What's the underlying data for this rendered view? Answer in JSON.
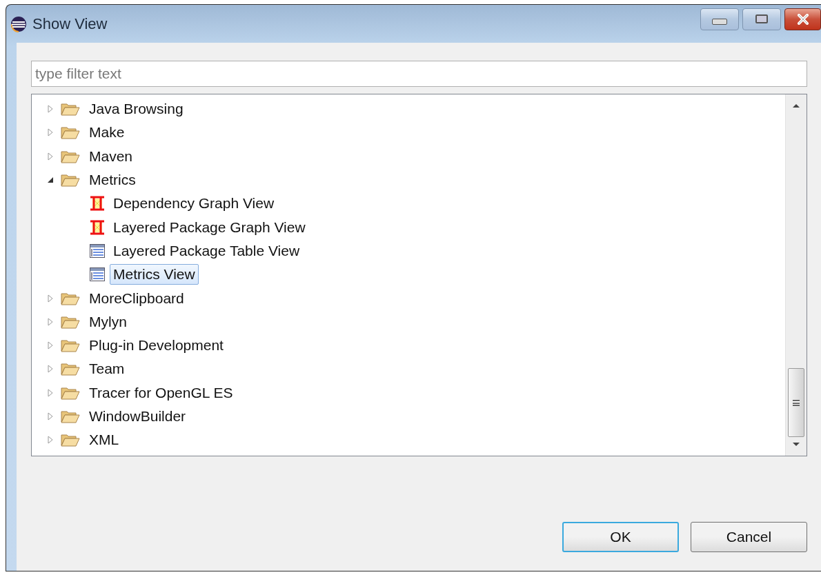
{
  "window": {
    "title": "Show View"
  },
  "filter": {
    "placeholder": "type filter text"
  },
  "tree": [
    {
      "label": "Java Browsing",
      "kind": "folder",
      "expanded": false
    },
    {
      "label": "Make",
      "kind": "folder",
      "expanded": false
    },
    {
      "label": "Maven",
      "kind": "folder",
      "expanded": false
    },
    {
      "label": "Metrics",
      "kind": "folder",
      "expanded": true,
      "children": [
        {
          "label": "Dependency Graph View",
          "kind": "graph",
          "selected": false
        },
        {
          "label": "Layered Package Graph View",
          "kind": "graph",
          "selected": false
        },
        {
          "label": "Layered Package Table View",
          "kind": "table",
          "selected": false
        },
        {
          "label": "Metrics View",
          "kind": "table",
          "selected": true
        }
      ]
    },
    {
      "label": "MoreClipboard",
      "kind": "folder",
      "expanded": false
    },
    {
      "label": "Mylyn",
      "kind": "folder",
      "expanded": false
    },
    {
      "label": "Plug-in Development",
      "kind": "folder",
      "expanded": false
    },
    {
      "label": "Team",
      "kind": "folder",
      "expanded": false
    },
    {
      "label": "Tracer for OpenGL ES",
      "kind": "folder",
      "expanded": false
    },
    {
      "label": "WindowBuilder",
      "kind": "folder",
      "expanded": false
    },
    {
      "label": "XML",
      "kind": "folder",
      "expanded": false
    }
  ],
  "buttons": [
    {
      "label": "OK",
      "default": true
    },
    {
      "label": "Cancel",
      "default": false
    }
  ]
}
